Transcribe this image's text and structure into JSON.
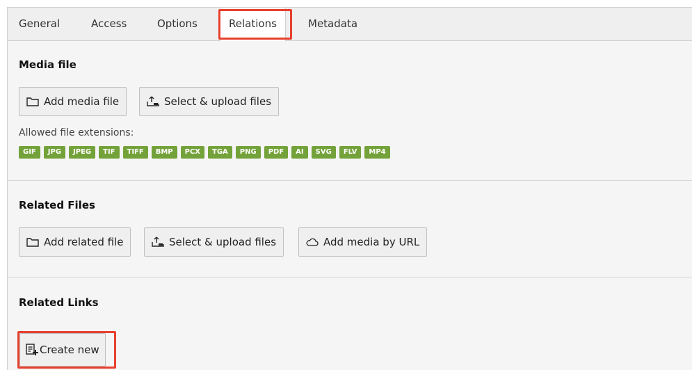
{
  "tabs": [
    {
      "label": "General"
    },
    {
      "label": "Access"
    },
    {
      "label": "Options"
    },
    {
      "label": "Relations",
      "active": true
    },
    {
      "label": "Metadata"
    }
  ],
  "media_file": {
    "title": "Media file",
    "add_button": "Add media file",
    "upload_button": "Select & upload files",
    "allowed_label": "Allowed file extensions:",
    "extensions": [
      "GIF",
      "JPG",
      "JPEG",
      "TIF",
      "TIFF",
      "BMP",
      "PCX",
      "TGA",
      "PNG",
      "PDF",
      "AI",
      "SVG",
      "FLV",
      "MP4"
    ]
  },
  "related_files": {
    "title": "Related Files",
    "add_button": "Add related file",
    "upload_button": "Select & upload files",
    "url_button": "Add media by URL"
  },
  "related_links": {
    "title": "Related Links",
    "create_button": "Create new"
  },
  "colors": {
    "highlight": "#e8402d",
    "badge": "#74a23a"
  }
}
